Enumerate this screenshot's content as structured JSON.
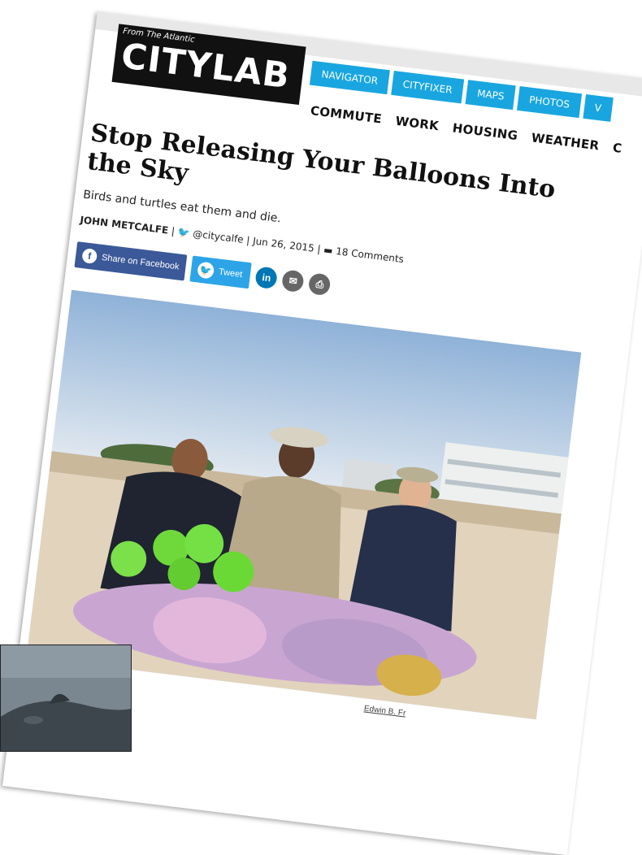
{
  "site": {
    "from_label": "From The Atlantic",
    "logo_text": "CITYLAB",
    "tabs": [
      "NAVIGATOR",
      "CITYFIXER",
      "MAPS",
      "PHOTOS",
      "V"
    ],
    "nav": [
      "COMMUTE",
      "WORK",
      "HOUSING",
      "WEATHER",
      "C"
    ]
  },
  "article": {
    "headline": "Stop Releasing Your Balloons Into the Sky",
    "dek": "Birds and turtles eat them and die.",
    "byline": {
      "author": "JOHN METCALFE",
      "twitter": "@citycalfe",
      "date": "Jun 26, 2015",
      "comments": "18 Comments"
    },
    "share": {
      "facebook": "Share on Facebook",
      "tweet": "Tweet",
      "linkedin": "in"
    },
    "photo_caption": "Edwin B. Fr"
  },
  "icons": [
    "facebook-icon",
    "twitter-icon",
    "linkedin-icon",
    "email-icon",
    "print-icon",
    "comment-icon"
  ],
  "colors": {
    "tab_blue": "#19a6e0",
    "facebook": "#3b5998",
    "twitter": "#2da4e8",
    "linkedin": "#0077b5"
  }
}
